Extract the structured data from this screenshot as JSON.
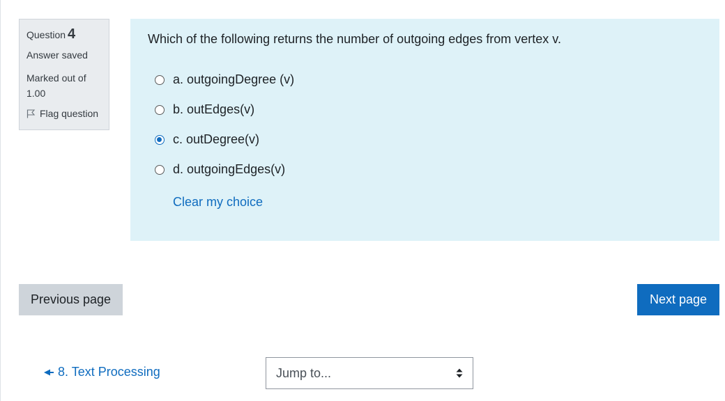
{
  "question": {
    "label": "Question",
    "number": "4",
    "state": "Answer saved",
    "grade": "Marked out of 1.00",
    "flag_label": "Flag question",
    "text": "Which of the following returns the number of outgoing edges from vertex v.",
    "answers": [
      {
        "label": "a. outgoingDegree (v)",
        "checked": false
      },
      {
        "label": "b. outEdges(v)",
        "checked": false
      },
      {
        "label": "c. outDegree(v)",
        "checked": true
      },
      {
        "label": "d. outgoingEdges(v)",
        "checked": false
      }
    ],
    "clear_label": "Clear my choice"
  },
  "navigation": {
    "previous_label": "Previous page",
    "next_label": "Next page",
    "previous_activity": "8. Text Processing",
    "jump_placeholder": "Jump to..."
  },
  "colors": {
    "accent": "#0f6cbf",
    "content_bg": "#def2f8",
    "info_bg": "#e9ecef",
    "prev_button_bg": "#ced4da"
  },
  "icons": {
    "flag": "flag-icon",
    "previous_activity": "arrow-left-icon",
    "jump_select": "select-caret-icon"
  }
}
